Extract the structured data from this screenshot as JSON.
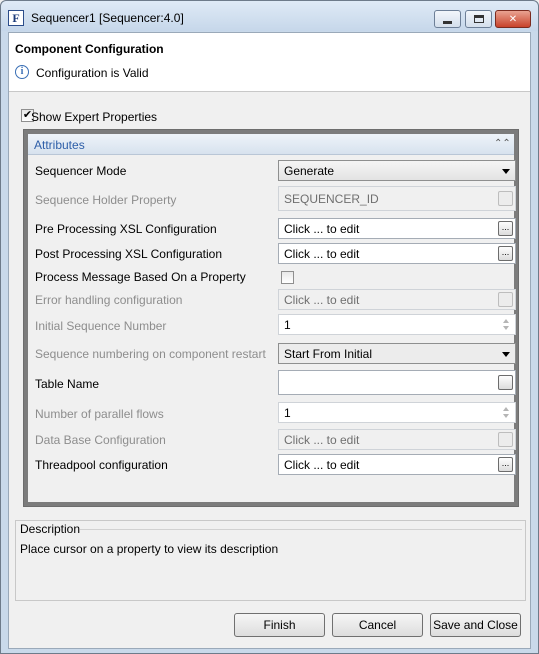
{
  "window": {
    "icon_glyph": "F",
    "title": "Sequencer1 [Sequencer:4.0]"
  },
  "header": {
    "title": "Component Configuration",
    "status_icon": "info-icon",
    "status": "Configuration is Valid"
  },
  "expert": {
    "checked": true,
    "check_glyph": "✔",
    "label": "Show Expert Properties"
  },
  "attributes": {
    "title": "Attributes",
    "collapse_glyph": "⌃⌃",
    "rows": [
      {
        "label": "Sequencer Mode",
        "value": "Generate",
        "kind": "select",
        "disabled": false
      },
      {
        "label": "Sequence Holder Property",
        "value": "SEQUENCER_ID",
        "kind": "text-ellipsis",
        "disabled": true
      },
      {
        "label": "Pre Processing XSL Configuration",
        "value": "Click ... to edit",
        "kind": "ellipsis",
        "disabled": false
      },
      {
        "label": "Post Processing XSL Configuration",
        "value": "Click ... to edit",
        "kind": "ellipsis",
        "disabled": false
      },
      {
        "label": "Process Message Based On a Property",
        "value": "",
        "kind": "checkbox",
        "disabled": false
      },
      {
        "label": "Error handling configuration",
        "value": "Click ... to edit",
        "kind": "ellipsis",
        "disabled": true
      },
      {
        "label": "Initial Sequence Number",
        "value": "1",
        "kind": "spinner",
        "disabled": true
      },
      {
        "label": "Sequence numbering on component restart",
        "value": "Start From Initial",
        "kind": "select",
        "disabled": true
      },
      {
        "label": "Table Name",
        "value": "",
        "kind": "text-ellipsis",
        "disabled": false
      },
      {
        "label": "Number of parallel flows",
        "value": "1",
        "kind": "spinner",
        "disabled": true
      },
      {
        "label": "Data Base Configuration",
        "value": "Click ... to edit",
        "kind": "ellipsis",
        "disabled": true
      },
      {
        "label": "Threadpool configuration",
        "value": "Click ... to edit",
        "kind": "ellipsis",
        "disabled": false
      }
    ],
    "ellipsis_glyph": "..."
  },
  "description": {
    "title": "Description",
    "text": "Place cursor on a property to view its description"
  },
  "buttons": {
    "finish": "Finish",
    "cancel": "Cancel",
    "save_close": "Save and Close"
  }
}
